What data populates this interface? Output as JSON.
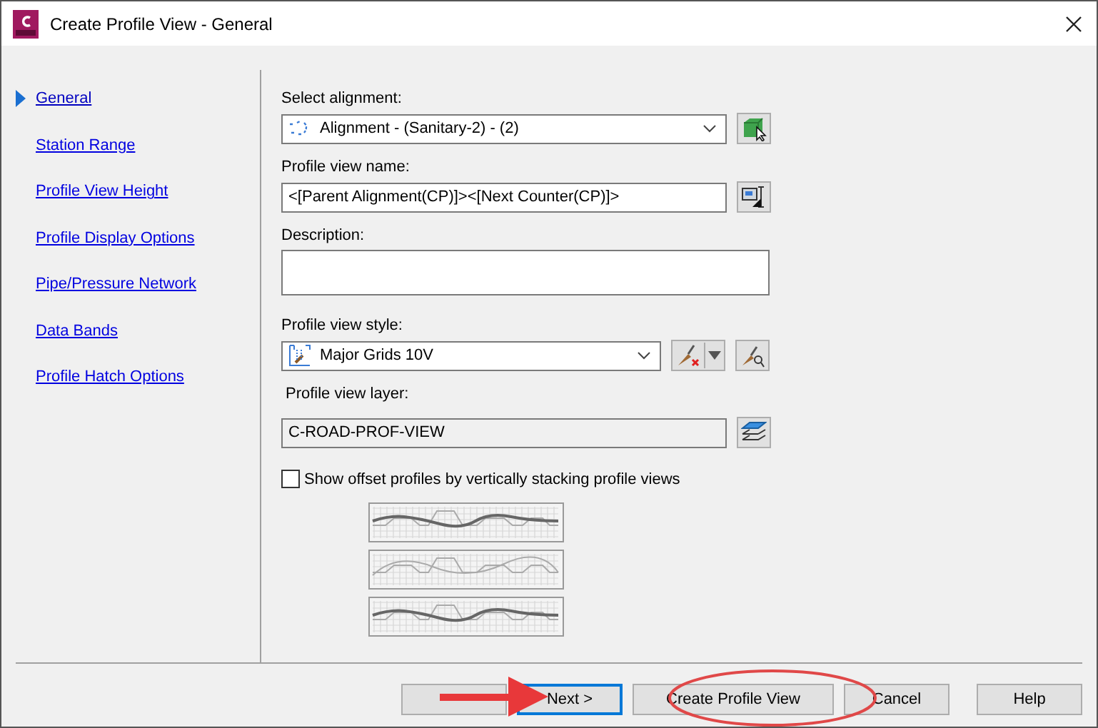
{
  "window": {
    "title": "Create Profile View - General"
  },
  "nav": [
    {
      "label": "General",
      "selected": true
    },
    {
      "label": "Station Range",
      "selected": false
    },
    {
      "label": "Profile View Height",
      "selected": false
    },
    {
      "label": "Profile Display Options",
      "selected": false
    },
    {
      "label": "Pipe/Pressure Network",
      "selected": false
    },
    {
      "label": "Data Bands",
      "selected": false
    },
    {
      "label": "Profile Hatch Options",
      "selected": false
    }
  ],
  "select_alignment": {
    "label": "Select alignment:",
    "value": "Alignment - (Sanitary-2) - (2)"
  },
  "profile_view_name": {
    "label": "Profile view name:",
    "value": "<[Parent Alignment(CP)]><[Next Counter(CP)]>"
  },
  "description": {
    "label": "Description:"
  },
  "profile_view_style": {
    "label": "Profile view style:",
    "value": "Major Grids 10V"
  },
  "profile_view_layer": {
    "label": "Profile view layer:",
    "value": "C-ROAD-PROF-VIEW"
  },
  "stack_option": {
    "label": "Show offset profiles by vertically stacking profile views",
    "checked": false
  },
  "buttons": [
    {
      "label": "Next >",
      "focused": true
    },
    {
      "label": "Create Profile View",
      "focused": false
    },
    {
      "label": "Cancel",
      "focused": false
    },
    {
      "label": "Help",
      "focused": false
    }
  ]
}
